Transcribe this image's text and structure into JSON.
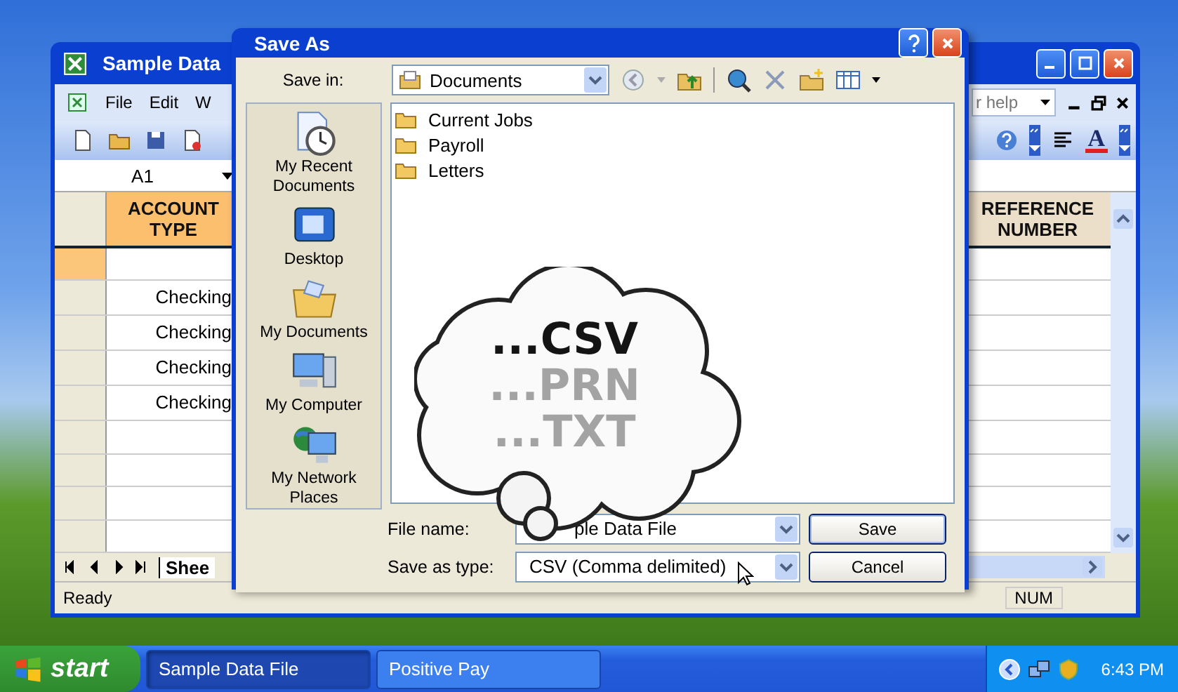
{
  "excel_window": {
    "title": "Sample Data",
    "menu": [
      "File",
      "Edit",
      "W"
    ],
    "help_box": "r help",
    "font_color_label": "A",
    "name_box": "A1",
    "columns": [
      {
        "heading": "ACCOUNT TYPE"
      },
      {
        "heading": "REFERENCE NUMBER"
      }
    ],
    "rows": [
      {
        "selected": true
      },
      {
        "selected": false,
        "account_type": "Checking"
      },
      {
        "selected": false,
        "account_type": "Checking"
      },
      {
        "selected": false,
        "account_type": "Checking"
      },
      {
        "selected": false,
        "account_type": "Checking"
      },
      {
        "selected": false
      },
      {
        "selected": false
      },
      {
        "selected": false
      },
      {
        "selected": false
      }
    ],
    "sheet_tab": "Shee",
    "status": "Ready",
    "indicator": "NUM"
  },
  "dialog": {
    "title": "Save As",
    "save_in_label": "Save in:",
    "location": "Documents",
    "places": [
      {
        "label": "My Recent Documents",
        "kind": "recent"
      },
      {
        "label": "Desktop",
        "kind": "desktop"
      },
      {
        "label": "My Documents",
        "kind": "documents"
      },
      {
        "label": "My Computer",
        "kind": "computer"
      },
      {
        "label": "My Network Places",
        "kind": "network"
      }
    ],
    "files": [
      "Current Jobs",
      "Payroll",
      "Letters"
    ],
    "file_name_label": "File name:",
    "file_name": "ple Data File",
    "type_label": "Save as type:",
    "file_type": "CSV (Comma delimited)",
    "buttons": [
      "Save",
      "Cancel"
    ]
  },
  "callout": {
    "lines": [
      {
        "text": "...CSV",
        "highlighted": true
      },
      {
        "text": "...PRN",
        "highlighted": false
      },
      {
        "text": "...TXT",
        "highlighted": false
      }
    ]
  },
  "taskbar": {
    "start": "start",
    "tasks": [
      {
        "label": "Sample Data File",
        "selected": true
      },
      {
        "label": "Positive Pay",
        "selected": false
      }
    ],
    "clock": "6:43 PM"
  }
}
